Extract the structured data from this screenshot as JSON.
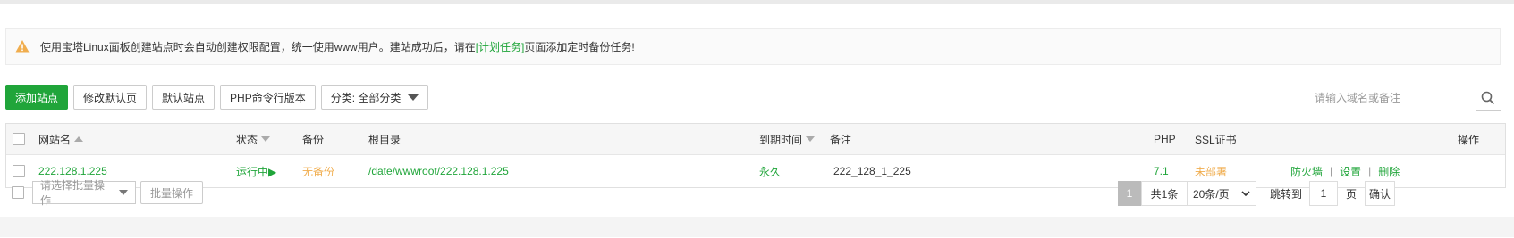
{
  "alert": {
    "text_before": "使用宝塔Linux面板创建站点时会自动创建权限配置，统一使用www用户。建站成功后，请在",
    "link_text": "[计划任务]",
    "text_after": "页面添加定时备份任务!"
  },
  "toolbar": {
    "add_site": "添加站点",
    "edit_default_page": "修改默认页",
    "default_site": "默认站点",
    "php_cli_version": "PHP命令行版本",
    "category_label": "分类: 全部分类"
  },
  "search": {
    "placeholder": "请输入域名或备注"
  },
  "table": {
    "headers": {
      "site_name": "网站名",
      "status": "状态",
      "backup": "备份",
      "root_dir": "根目录",
      "expire": "到期时间",
      "remark": "备注",
      "php": "PHP",
      "ssl": "SSL证书",
      "actions": "操作"
    },
    "rows": [
      {
        "site_name": "222.128.1.225",
        "status": "运行中▶",
        "backup": "无备份",
        "root_dir": "/date/wwwroot/222.128.1.225",
        "expire": "永久",
        "remark": "222_128_1_225",
        "php": "7.1",
        "ssl": "未部署",
        "actions": [
          "防火墙",
          "设置",
          "删除"
        ]
      }
    ]
  },
  "footer": {
    "batch_select_placeholder": "请选择批量操作",
    "batch_button": "批量操作",
    "current_page": "1",
    "total": "共1条",
    "page_size": "20条/页",
    "jump_label": "跳转到",
    "jump_value": "1",
    "page_unit": "页",
    "confirm": "确认"
  },
  "colors": {
    "accent": "#20a53a",
    "warning": "#f0ad4e"
  }
}
